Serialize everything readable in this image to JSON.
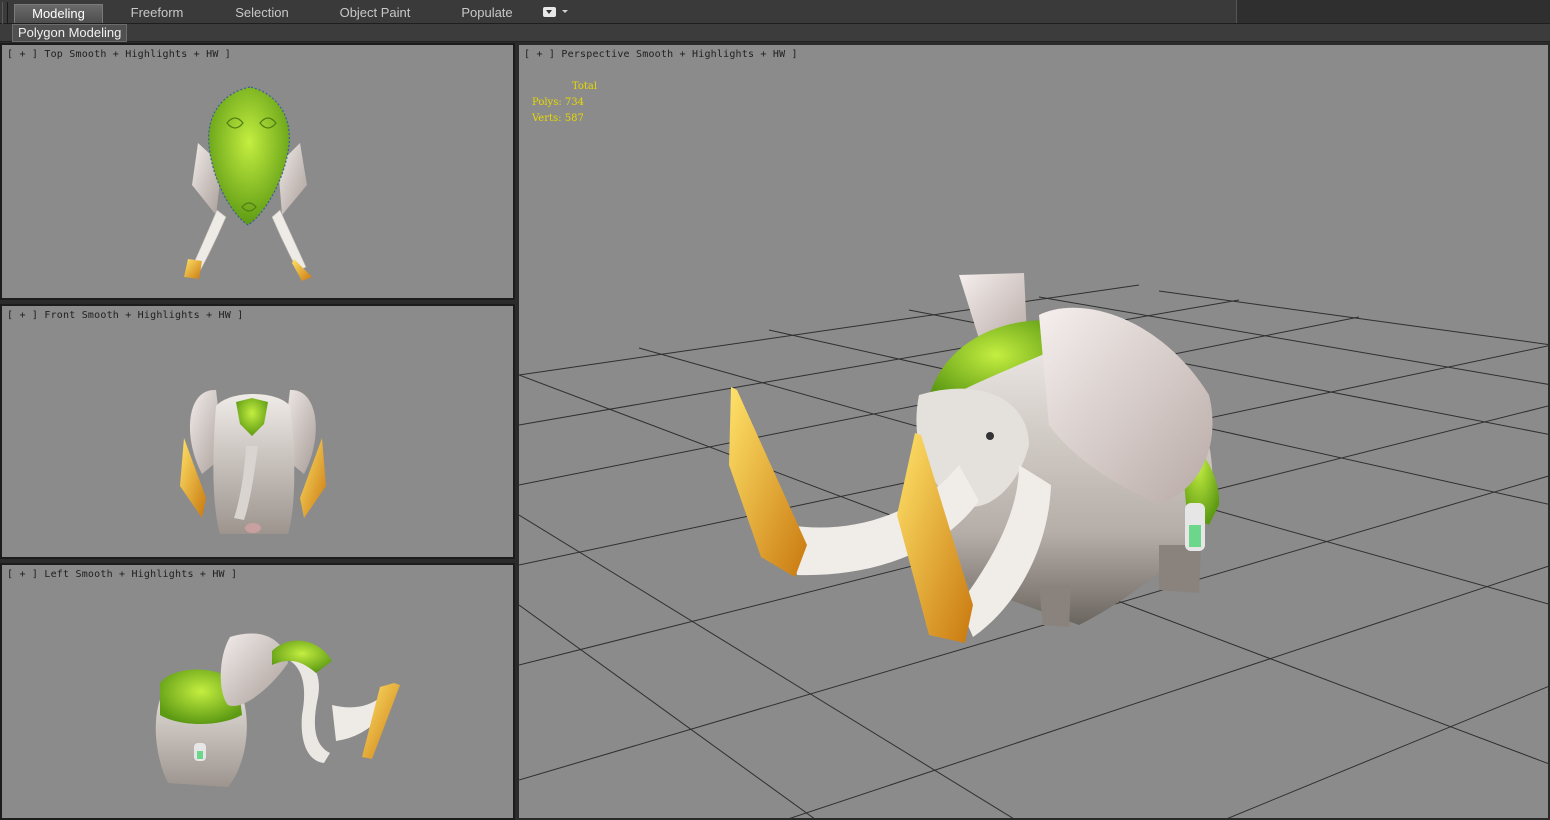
{
  "ribbon": {
    "tabs": [
      {
        "label": "Modeling",
        "active": true
      },
      {
        "label": "Freeform",
        "active": false
      },
      {
        "label": "Selection",
        "active": false
      },
      {
        "label": "Object Paint",
        "active": false
      },
      {
        "label": "Populate",
        "active": false
      }
    ],
    "options_icon": "dropdown-menu-icon"
  },
  "subbar": {
    "panel_label": "Polygon Modeling"
  },
  "viewports": {
    "top": {
      "open": "[ + ]",
      "view": "Top",
      "shading": "Smooth + Highlights + HW",
      "close": "]"
    },
    "front": {
      "open": "[ + ]",
      "view": "Front",
      "shading": "Smooth + Highlights + HW",
      "close": "]"
    },
    "left": {
      "open": "[ + ]",
      "view": "Left",
      "shading": "Smooth + Highlights + HW",
      "close": "]"
    },
    "perspective": {
      "open": "[ + ]",
      "view": "Perspective",
      "shading": "Smooth + Highlights + HW",
      "close": "]"
    }
  },
  "stats": {
    "header": "Total",
    "polys_label": "Polys:",
    "polys_value": "734",
    "verts_label": "Verts:",
    "verts_value": "587"
  },
  "colors": {
    "viewport_bg": "#8b8b8b",
    "stats_text": "#e8d800",
    "saddle_green": "#8ac22a",
    "tusk_gold": "#e0a020",
    "elephant_white": "#e8e4e0"
  },
  "model": {
    "name": "elephant-model"
  }
}
